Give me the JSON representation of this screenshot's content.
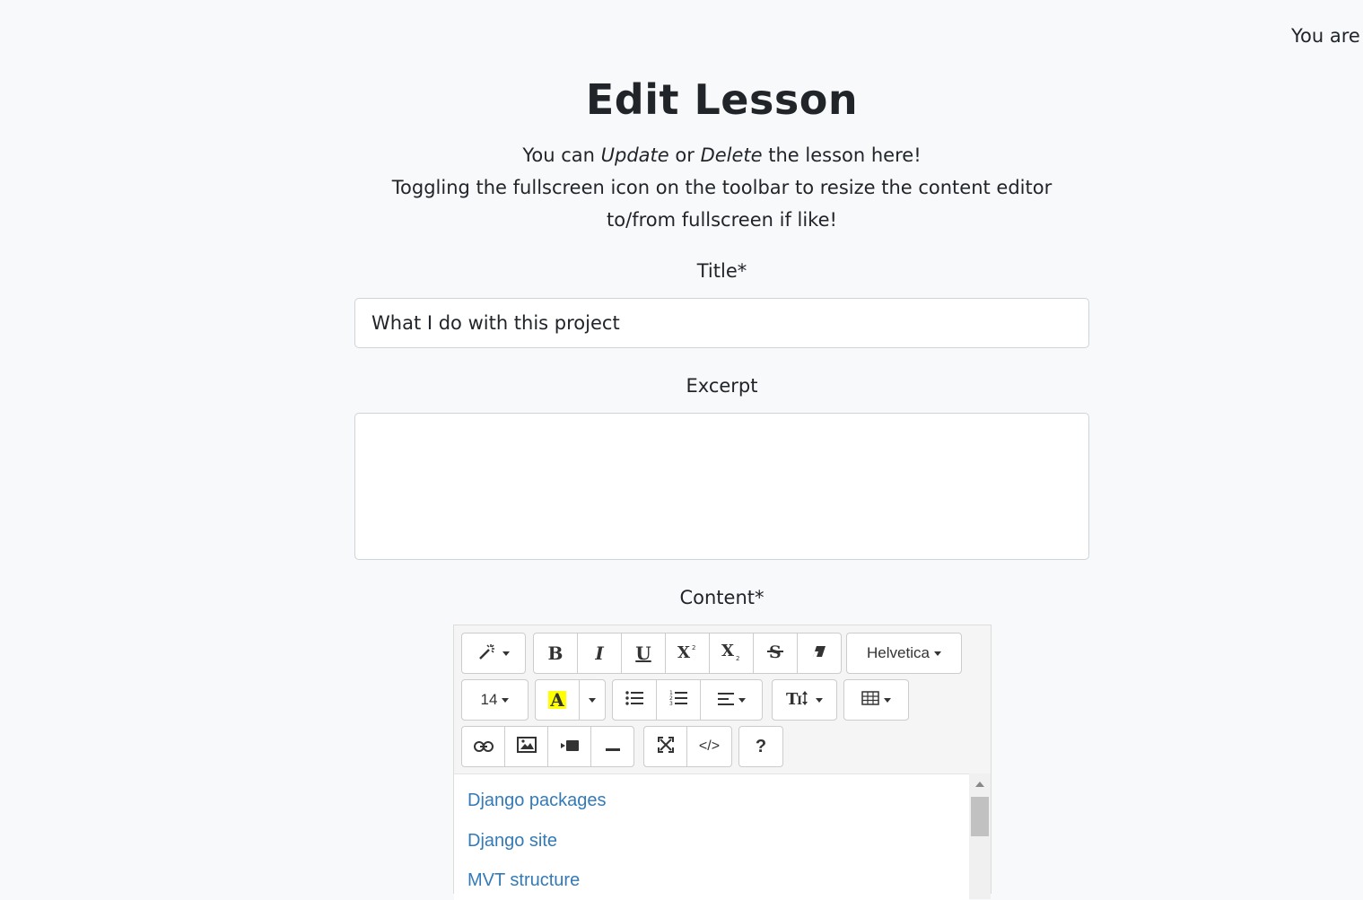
{
  "header": {
    "user_text": "You are"
  },
  "page": {
    "title": "Edit Lesson",
    "intro_prefix": "You can",
    "intro_update": "Update",
    "intro_or": "or",
    "intro_delete": "Delete",
    "intro_suffix": "the lesson here!",
    "intro_line2": "Toggling the fullscreen icon on the toolbar to resize the content editor",
    "intro_line3": "to/from fullscreen if like!"
  },
  "form": {
    "title_label": "Title*",
    "title_value": "What I do with this project",
    "excerpt_label": "Excerpt",
    "excerpt_value": "",
    "content_label": "Content*"
  },
  "editor": {
    "toolbar": {
      "bold": "B",
      "italic": "I",
      "underline": "U",
      "font_family": "Helvetica",
      "font_size": "14",
      "color_letter": "A",
      "help": "?",
      "code": "</>"
    },
    "content_links": [
      "Django packages",
      "Django site",
      "MVT structure"
    ],
    "colors": {
      "link": "#337ab7",
      "highlight": "#ffff00"
    }
  }
}
